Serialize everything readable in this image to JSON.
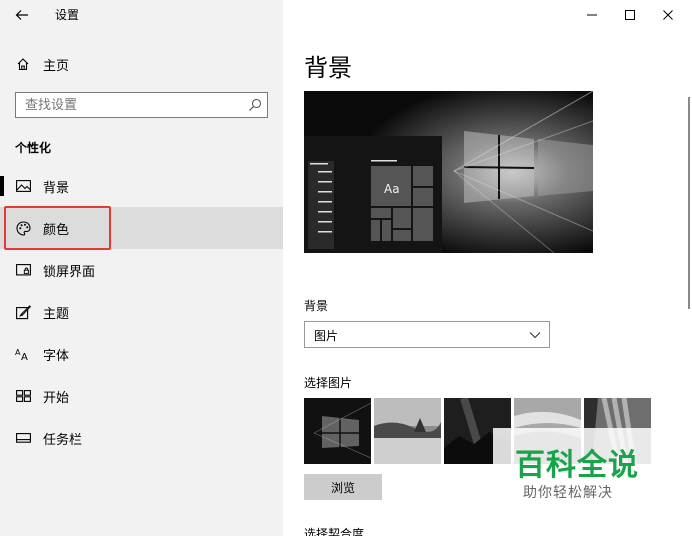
{
  "window": {
    "title": "设置",
    "controls": {
      "minimize": "minimize-icon",
      "maximize": "maximize-icon",
      "close": "close-icon"
    }
  },
  "sidebar": {
    "home_label": "主页",
    "search_placeholder": "查找设置",
    "section_title": "个性化",
    "items": [
      {
        "label": "背景",
        "icon": "picture-icon",
        "active": false
      },
      {
        "label": "颜色",
        "icon": "palette-icon",
        "active": true
      },
      {
        "label": "锁屏界面",
        "icon": "lock-screen-icon",
        "active": false
      },
      {
        "label": "主题",
        "icon": "theme-brush-icon",
        "active": false
      },
      {
        "label": "字体",
        "icon": "font-icon",
        "active": false
      },
      {
        "label": "开始",
        "icon": "start-layout-icon",
        "active": false
      },
      {
        "label": "任务栏",
        "icon": "taskbar-icon",
        "active": false
      }
    ]
  },
  "main": {
    "title": "背景",
    "preview": {
      "tile_text": "Aa"
    },
    "background_label": "背景",
    "background_value": "图片",
    "choose_picture_label": "选择图片",
    "browse_label": "浏览",
    "fit_label": "选择契合度"
  },
  "watermark": {
    "main": "百科全说",
    "sub": "助你轻松解决"
  },
  "colors": {
    "sidebar_bg": "#f2f2f2",
    "active_item_bg": "#dcdcdc",
    "highlight_border": "#e53935",
    "watermark_green": "#19a34a"
  }
}
